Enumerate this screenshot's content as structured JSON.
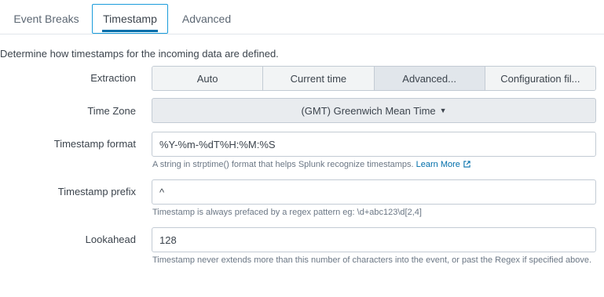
{
  "tabs": [
    {
      "label": "Event Breaks",
      "active": false
    },
    {
      "label": "Timestamp",
      "active": true
    },
    {
      "label": "Advanced",
      "active": false
    }
  ],
  "intro": "Determine how timestamps for the incoming data are defined.",
  "extraction": {
    "label": "Extraction",
    "options": [
      "Auto",
      "Current time",
      "Advanced...",
      "Configuration fil..."
    ],
    "selected": "Advanced..."
  },
  "time_zone": {
    "label": "Time Zone",
    "value": "(GMT) Greenwich Mean Time"
  },
  "timestamp_format": {
    "label": "Timestamp format",
    "value": "%Y-%m-%dT%H:%M:%S",
    "help": "A string in strptime() format that helps Splunk recognize timestamps.",
    "link": "Learn More"
  },
  "timestamp_prefix": {
    "label": "Timestamp prefix",
    "value": "^",
    "help": "Timestamp is always prefaced by a regex pattern eg: \\d+abc123\\d[2,4]"
  },
  "lookahead": {
    "label": "Lookahead",
    "value": "128",
    "help": "Timestamp never extends more than this number of characters into the event, or past the Regex if specified above."
  },
  "colors": {
    "accent": "#006eaa",
    "tab_border": "#1a9cdb"
  }
}
